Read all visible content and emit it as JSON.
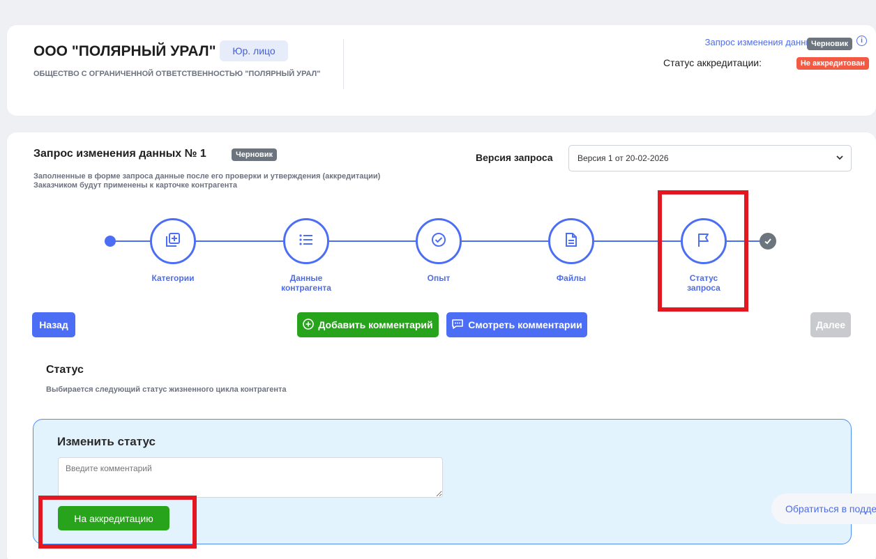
{
  "company": {
    "name": "ООО \"ПОЛЯРНЫЙ УРАЛ\"",
    "type_badge": "Юр. лицо",
    "full_name": "ОБЩЕСТВО С ОГРАНИЧЕННОЙ ОТВЕТСТВЕННОСТЬЮ \"ПОЛЯРНЫЙ УРАЛ\""
  },
  "header_right": {
    "request_link": "Запрос изменения данных №1",
    "draft_badge": "Черновик",
    "accreditation_label": "Статус аккредитации:",
    "accreditation_status": "Не аккредитован"
  },
  "request": {
    "title": "Запрос изменения данных № 1",
    "draft_badge": "Черновик",
    "description_line1": "Заполненные в форме запроса данные после его проверки и утверждения (аккредитации)",
    "description_line2": "Заказчиком будут применены к карточке контрагента",
    "version_label": "Версия запроса",
    "version_value": "Версия 1 от 20-02-2026"
  },
  "steps": [
    {
      "label1": "Категории",
      "label2": "",
      "icon": "add-box-icon"
    },
    {
      "label1": "Данные",
      "label2": "контрагента",
      "icon": "list-icon"
    },
    {
      "label1": "Опыт",
      "label2": "",
      "icon": "check-circle-icon"
    },
    {
      "label1": "Файлы",
      "label2": "",
      "icon": "document-icon"
    },
    {
      "label1": "Статус",
      "label2": "запроса",
      "icon": "flag-icon"
    }
  ],
  "buttons": {
    "back": "Назад",
    "add_comment": "Добавить комментарий",
    "view_comments": "Смотреть комментарии",
    "next": "Далее"
  },
  "status_section": {
    "title": "Статус",
    "subtitle": "Выбирается следующий статус жизненного цикла контрагента",
    "change_title": "Изменить статус",
    "comment_placeholder": "Введите комментарий",
    "submit_button": "На аккредитацию"
  },
  "support": {
    "label": "Обратиться в подде"
  },
  "colors": {
    "accent": "#4c6ef5",
    "green": "#28a31c",
    "red_badge": "#f25a43",
    "highlight": "#e3171f"
  }
}
